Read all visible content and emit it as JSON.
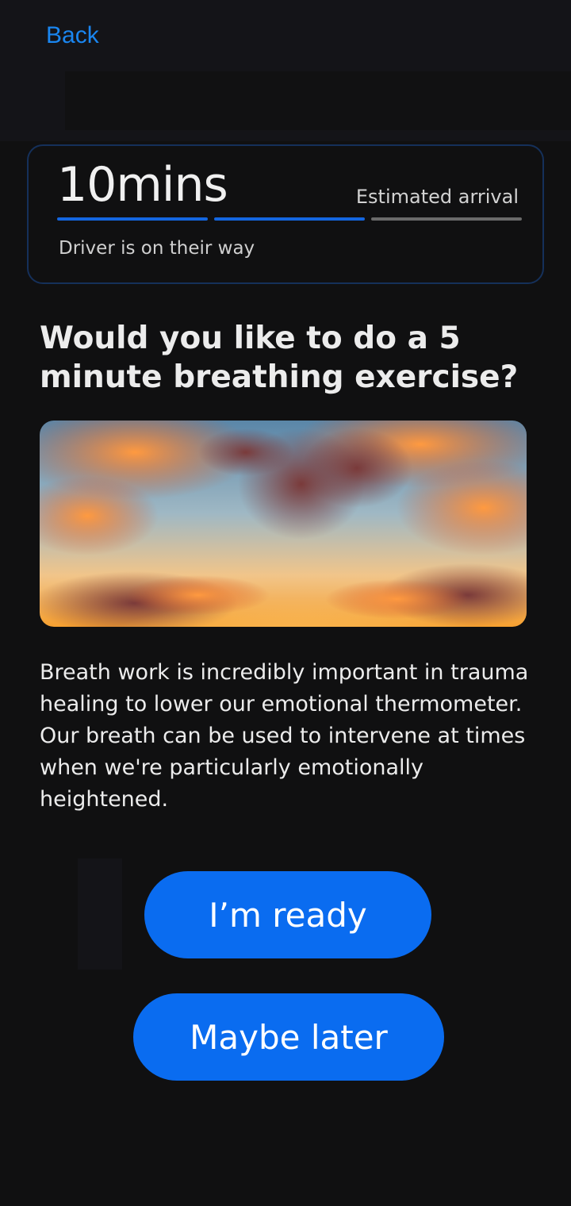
{
  "header": {
    "back_label": "Back"
  },
  "eta": {
    "time": "10mins",
    "label": "Estimated arrival",
    "status": "Driver is on their way",
    "progress_segments_total": 3,
    "progress_segments_filled": 2,
    "accent_color": "#1466e0"
  },
  "content": {
    "question": "Would you like to do a 5 minute breathing exercise?",
    "image_subject": "sunset-sky-clouds",
    "description": "Breath work is incredibly important in trauma healing to lower our emotional thermometer. Our breath can be used to intervene at times when we're particularly emotionally heightened."
  },
  "actions": {
    "ready_label": "I’m ready",
    "later_label": "Maybe later",
    "button_color": "#0a6cf0"
  }
}
